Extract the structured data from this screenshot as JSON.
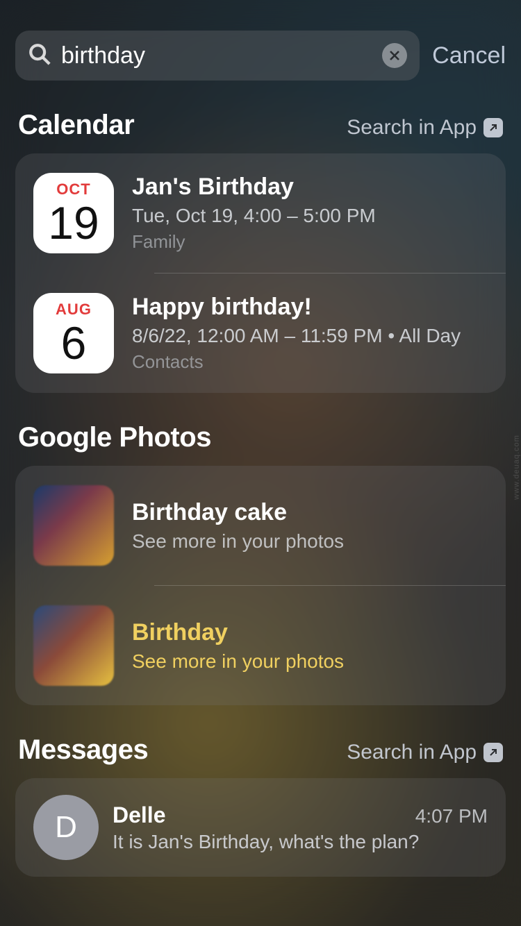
{
  "search": {
    "query": "birthday",
    "cancel_label": "Cancel"
  },
  "sections": {
    "calendar": {
      "title": "Calendar",
      "search_in_app_label": "Search in App",
      "items": [
        {
          "month": "OCT",
          "day": "19",
          "title": "Jan's Birthday",
          "subtitle": "Tue, Oct 19, 4:00 – 5:00 PM",
          "meta": "Family"
        },
        {
          "month": "AUG",
          "day": "6",
          "title": "Happy birthday!",
          "subtitle": "8/6/22, 12:00 AM – 11:59 PM • All Day",
          "meta": "Contacts"
        }
      ]
    },
    "google_photos": {
      "title": "Google Photos",
      "items": [
        {
          "title": "Birthday cake",
          "subtitle": "See more in your photos"
        },
        {
          "title": "Birthday",
          "subtitle": "See more in your photos"
        }
      ]
    },
    "messages": {
      "title": "Messages",
      "search_in_app_label": "Search in App",
      "items": [
        {
          "initial": "D",
          "name": "Delle",
          "time": "4:07 PM",
          "preview": "It is Jan's Birthday, what's the plan?"
        }
      ]
    }
  }
}
